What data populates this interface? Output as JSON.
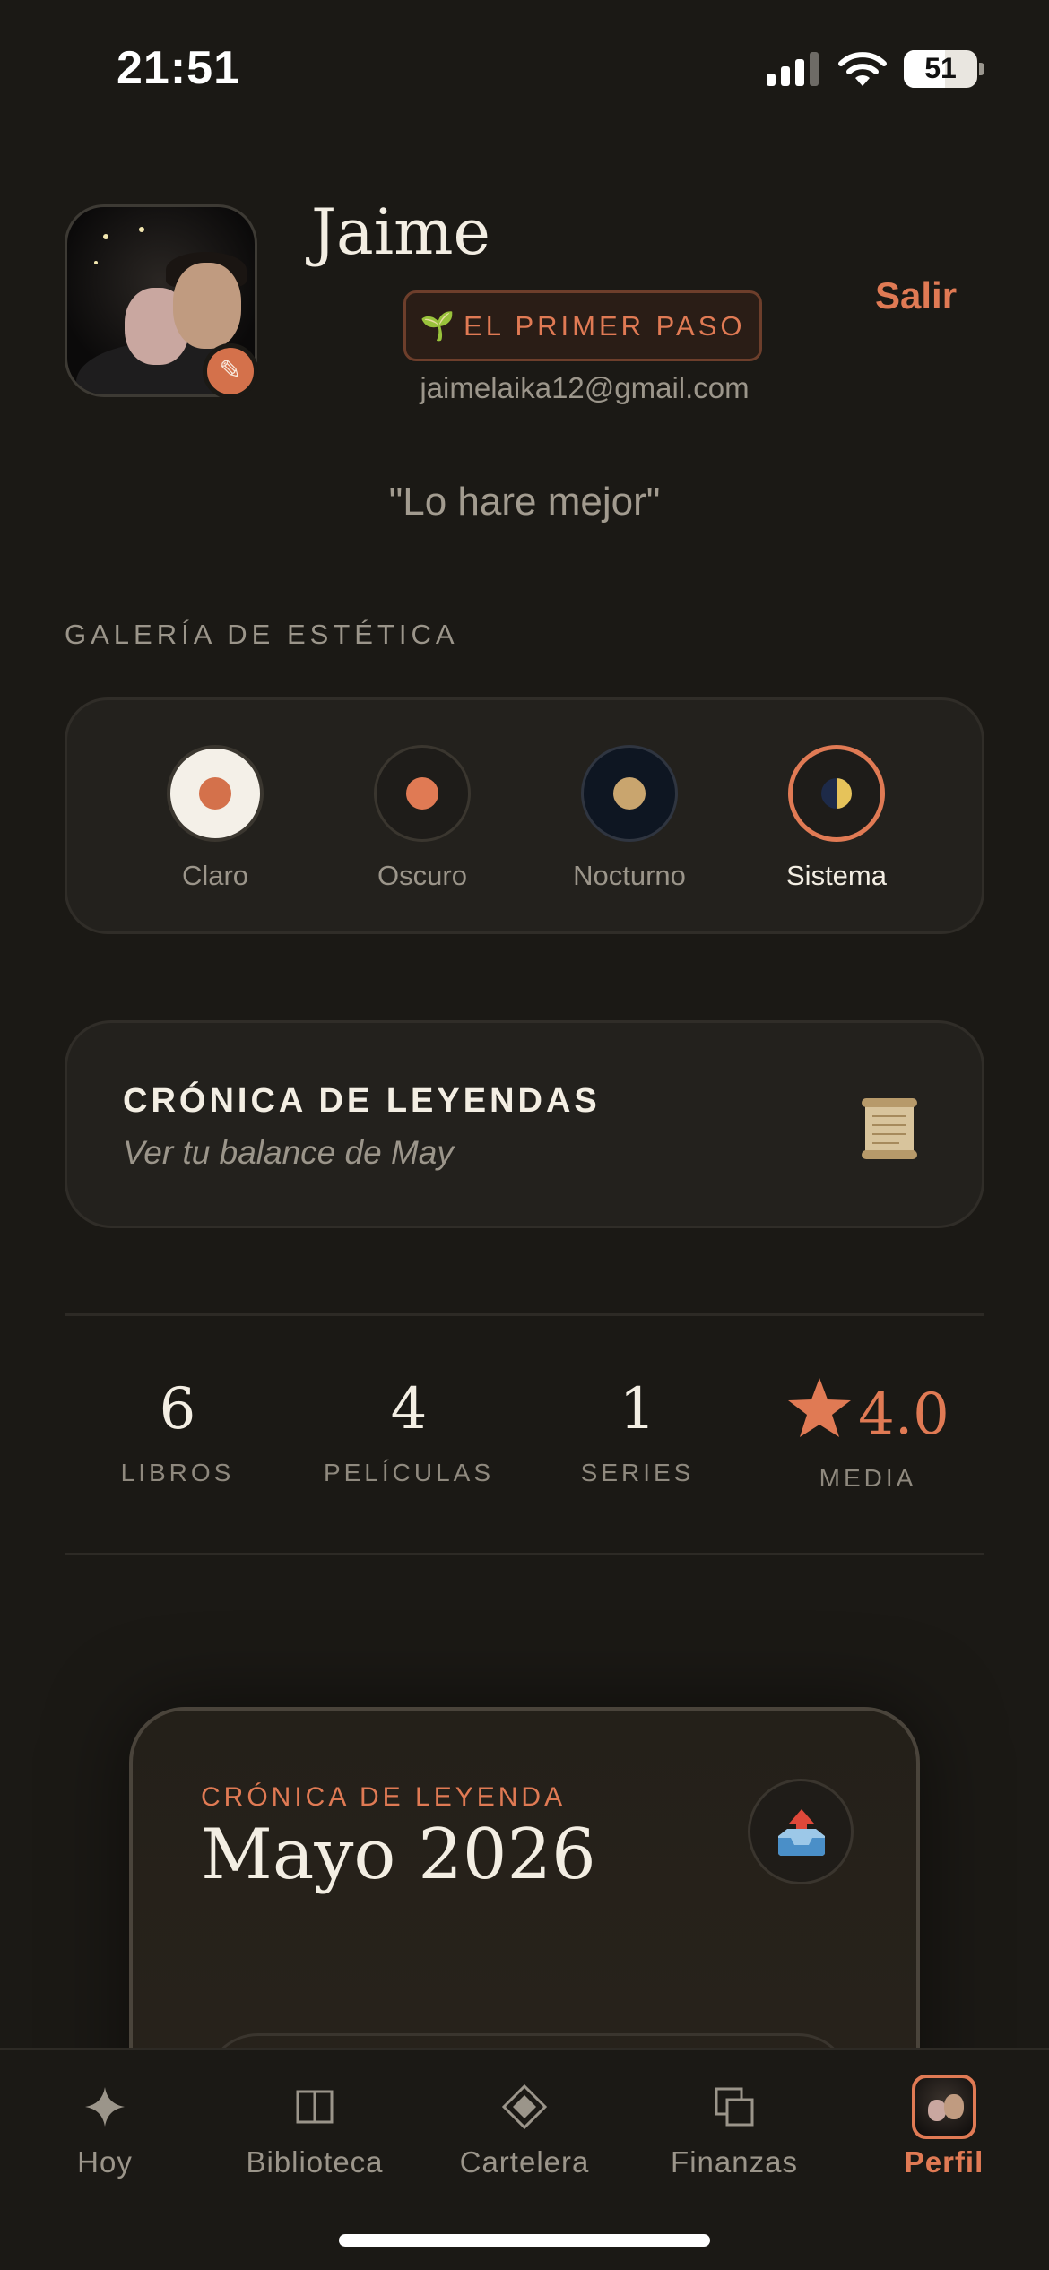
{
  "status": {
    "time": "21:51",
    "battery": "51"
  },
  "profile": {
    "name": "Jaime",
    "rank_icon": "🌱",
    "rank": "EL PRIMER PASO",
    "email": "jaimelaika12@gmail.com",
    "logout": "Salir",
    "quote": "\"Lo hare mejor\""
  },
  "gallery": {
    "title": "GALERÍA DE ESTÉTICA",
    "options": [
      {
        "label": "Claro"
      },
      {
        "label": "Oscuro"
      },
      {
        "label": "Nocturno"
      },
      {
        "label": "Sistema",
        "selected": true
      }
    ],
    "colors": {
      "accent": "#D4714B",
      "claro_bg": "#F4F0E8",
      "nocturno_bg": "#0E1622",
      "nocturno_dot": "#C9A56E"
    }
  },
  "chronicle": {
    "title": "CRÓNICA DE LEYENDAS",
    "subtitle": "Ver tu balance de May"
  },
  "stats": [
    {
      "value": "6",
      "label": "LIBROS"
    },
    {
      "value": "4",
      "label": "PELÍCULAS"
    },
    {
      "value": "1",
      "label": "SERIES"
    },
    {
      "value": "4.0",
      "label": "MEDIA",
      "icon": "star-icon"
    }
  ],
  "legend_card": {
    "kicker": "CRÓNICA DE LEYENDA",
    "title": "Mayo 2026"
  },
  "tabs": [
    {
      "label": "Hoy",
      "icon": "sparkle-icon"
    },
    {
      "label": "Biblioteca",
      "icon": "book-icon"
    },
    {
      "label": "Cartelera",
      "icon": "diamond-icon"
    },
    {
      "label": "Finanzas",
      "icon": "cards-icon"
    },
    {
      "label": "Perfil",
      "icon": "avatar-icon",
      "active": true
    }
  ]
}
